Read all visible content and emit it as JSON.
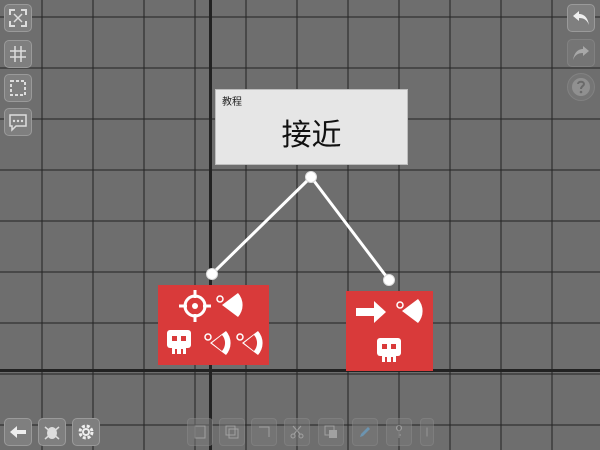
{
  "tutorial_card": {
    "label": "教程",
    "title": "接近"
  },
  "colors": {
    "canvas_background": "#6e6e6e",
    "node_red": "#d93a3a",
    "card_background": "#e6e6e6",
    "axis": "#222222"
  },
  "left_toolbar": [
    {
      "name": "fit-screen-icon"
    },
    {
      "name": "grid-icon"
    },
    {
      "name": "select-box-icon"
    },
    {
      "name": "comment-icon"
    }
  ],
  "right_toolbar": [
    {
      "name": "undo-icon"
    },
    {
      "name": "redo-icon"
    },
    {
      "name": "help-icon"
    }
  ],
  "bottom_left_toolbar": [
    {
      "name": "back-arrow-icon"
    },
    {
      "name": "bug-icon"
    },
    {
      "name": "settings-gear-icon"
    }
  ],
  "nodes": [
    {
      "name": "node-target-sense",
      "icons": [
        "crosshair-icon",
        "sensor-icon",
        "skull-icon",
        "sensor-icon",
        "sensor-icon"
      ]
    },
    {
      "name": "node-move-sense",
      "icons": [
        "arrow-right-icon",
        "sensor-icon",
        "skull-icon"
      ]
    }
  ]
}
